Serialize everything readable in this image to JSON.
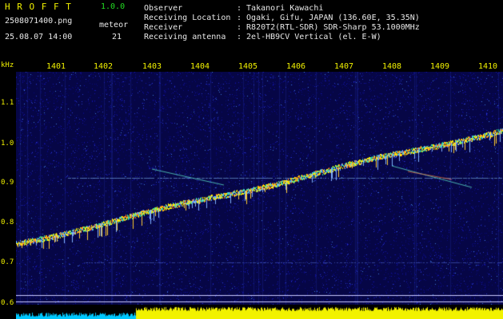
{
  "app": {
    "name": "H R O F F T",
    "version": "1.0.0",
    "filename": "2508071400.png",
    "datetime": "25.08.07 14:00",
    "meteor_label": "meteor",
    "meteor_count": "21"
  },
  "station": {
    "observer_label": "Observer",
    "observer_value": ": Takanori Kawachi",
    "location_label": "Receiving Location",
    "location_value": ": Ogaki, Gifu, JAPAN (136.60E, 35.35N)",
    "receiver_label": "Receiver",
    "receiver_value": ": R820T2(RTL-SDR) SDR-Sharp 53.1000MHz",
    "antenna_label": "Receiving antenna",
    "antenna_value": ": 2el-HB9CV Vertical (el. E-W)"
  },
  "axes": {
    "y_unit": "kHz",
    "x_ticks": [
      "1401",
      "1402",
      "1403",
      "1404",
      "1405",
      "1406",
      "1407",
      "1408",
      "1409",
      "1410"
    ],
    "y_ticks": [
      "1.1",
      "1.0",
      "0.9",
      "0.8",
      "0.7",
      "0.6"
    ]
  },
  "colors": {
    "title": "#f2f200",
    "version": "#22dd22",
    "text": "#e8e8e8",
    "background_noise": "#0a0a6a",
    "signal": "#ffee00",
    "strip_yellow": "#f2f200",
    "strip_cyan": "#00c8ff"
  }
}
